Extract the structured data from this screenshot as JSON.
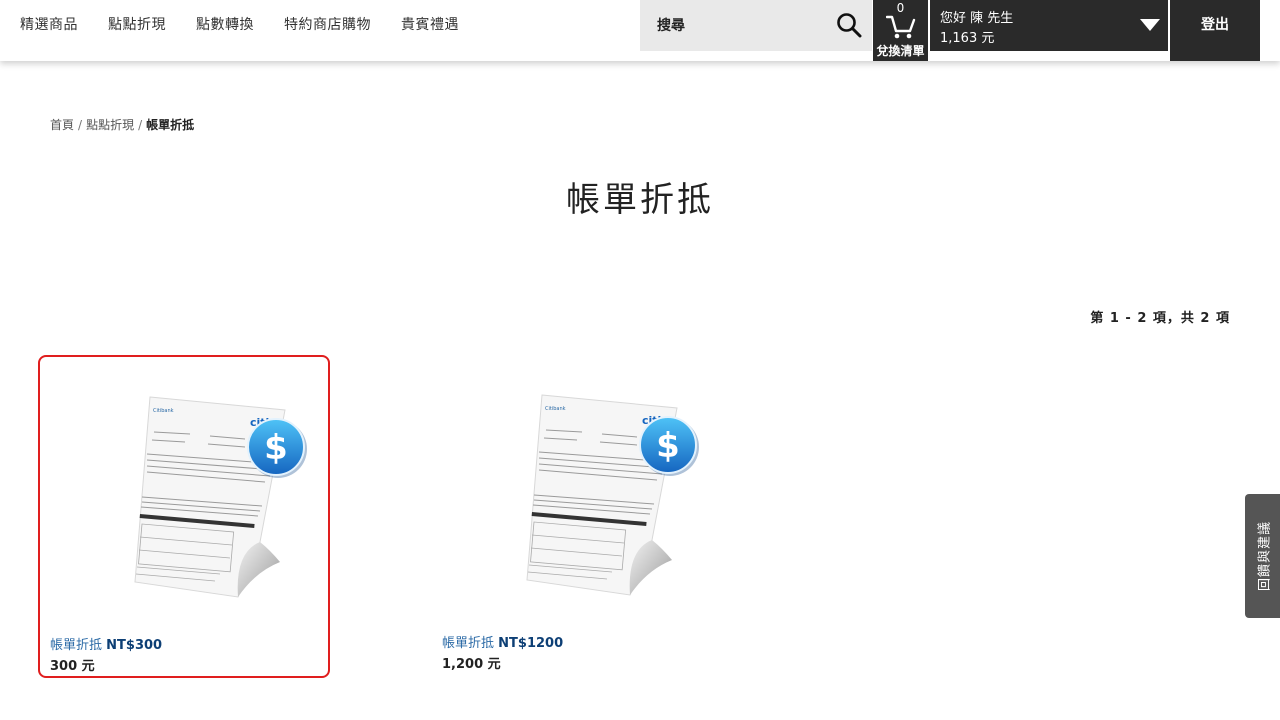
{
  "nav": {
    "items": [
      "精選商品",
      "點點折現",
      "點數轉換",
      "特約商店購物",
      "貴賓禮遇"
    ]
  },
  "search": {
    "placeholder": "搜尋",
    "icon": "search-icon"
  },
  "cart": {
    "count": "0",
    "label": "兌換清單",
    "icon": "cart-icon"
  },
  "user": {
    "greeting": "您好 陳 先生",
    "points": "1,163 元"
  },
  "logout": {
    "label": "登出"
  },
  "breadcrumb": {
    "items": [
      "首頁",
      "點點折現"
    ],
    "current": "帳單折抵"
  },
  "page": {
    "title": "帳單折抵"
  },
  "results": {
    "summary": "第 1 - 2 項，共 2 項"
  },
  "products": [
    {
      "name": "帳單折抵",
      "variant": "NT$300",
      "price": "300 元",
      "selected": true
    },
    {
      "name": "帳單折抵",
      "variant": "NT$1200",
      "price": "1,200 元",
      "selected": false
    }
  ],
  "statement_image": {
    "brand_small": "Citibank",
    "logo": "citi",
    "badge_symbol": "$"
  },
  "feedback": {
    "label": "回饋與建議"
  },
  "colors": {
    "dark": "#2a2a2a",
    "product_link": "#2b6aa6",
    "selected_border": "#e01e1e",
    "badge_blue": "#1e88e5"
  }
}
